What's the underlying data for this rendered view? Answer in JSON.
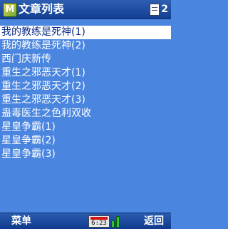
{
  "titlebar": {
    "app_icon_glyph": "M",
    "title": "文章列表",
    "page_count": "2"
  },
  "list": {
    "items": [
      {
        "label": "我的教练是死神(1)",
        "selected": true
      },
      {
        "label": "我的教练是死神(2)"
      },
      {
        "label": "西门庆新传"
      },
      {
        "label": "重生之邪恶天才(1)"
      },
      {
        "label": "重生之邪恶天才(2)"
      },
      {
        "label": "重生之邪恶天才(3)"
      },
      {
        "label": "蛊毒医生之色利双收"
      },
      {
        "label": "星皇争霸(1)"
      },
      {
        "label": "星皇争霸(2)"
      },
      {
        "label": "星皇争霸(3)"
      }
    ]
  },
  "softkeys": {
    "left_label": "菜单",
    "right_label": "返回"
  },
  "status": {
    "time": "6:23"
  },
  "colors": {
    "background": "#4a86e0",
    "selection": "#ffffff",
    "selection_text": "#0b2a88",
    "titlebar": "#123f92",
    "battery": "#d01818",
    "signal": "#29c43a"
  },
  "icons": [
    "app-logo-icon",
    "page-indicator-icon",
    "battery-icon",
    "signal-icon"
  ]
}
